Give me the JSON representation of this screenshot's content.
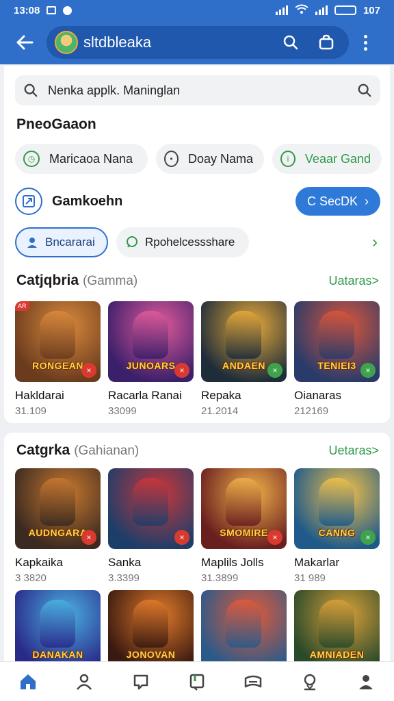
{
  "status_bar": {
    "time": "13:08",
    "right_text": "107"
  },
  "app_bar": {
    "title": "sltdbleaka"
  },
  "search": {
    "text": "Nenka applk. Maninglan"
  },
  "section": {
    "title": "PneoGaaon"
  },
  "chips": [
    {
      "label": "Maricaoa Nana"
    },
    {
      "label": "Doay Nama"
    },
    {
      "label": "Veaar Gand"
    }
  ],
  "game_row": {
    "label": "Gamkoehn",
    "button_label": "C SecDK"
  },
  "tags": [
    {
      "label": "Bncararai"
    },
    {
      "label": "Rpohelcessshare"
    }
  ],
  "categories": [
    {
      "title": "Catjqbria",
      "subtitle": "(Gamma)",
      "link": "Uataras>",
      "items": [
        {
          "name": "Hakldarai",
          "count": "31.109",
          "thumb_title": "RONGEAN",
          "corner": "AR",
          "badge": "red",
          "colors": [
            "#6b3b1e",
            "#d98a3c"
          ]
        },
        {
          "name": "Racarla Ranai",
          "count": "33099",
          "thumb_title": "JUNOARS",
          "badge": "red",
          "colors": [
            "#3a1f6a",
            "#e05a9a"
          ]
        },
        {
          "name": "Repaka",
          "count": "21.2014",
          "thumb_title": "ANDAEN",
          "badge": "green",
          "colors": [
            "#1f2d3a",
            "#e6a93a"
          ]
        },
        {
          "name": "Oianaras",
          "count": "212169",
          "thumb_title": "TENIEI3",
          "badge": "green",
          "colors": [
            "#2a3b6a",
            "#d9553a"
          ]
        }
      ]
    },
    {
      "title": "Catgrka",
      "subtitle": "(Gahianan)",
      "link": "Uetaras>",
      "items": [
        {
          "name": "Kapkaika",
          "count": "3 3820",
          "thumb_title": "AUDNGARA",
          "badge": "red",
          "colors": [
            "#3b2a20",
            "#c7782f"
          ]
        },
        {
          "name": "Sanka",
          "count": "3.3399",
          "thumb_title": "",
          "badge": "red",
          "colors": [
            "#1e3e6a",
            "#c9363a"
          ]
        },
        {
          "name": "Maplils Jolls",
          "count": "31.3899",
          "thumb_title": "SMOMIRE",
          "badge": "red",
          "colors": [
            "#6a1f1f",
            "#f0b04a"
          ]
        },
        {
          "name": "Makarlar",
          "count": "31 989",
          "thumb_title": "CANNG",
          "badge": "green",
          "colors": [
            "#1f5a8a",
            "#f0c04a"
          ]
        }
      ],
      "more": [
        {
          "thumb_title": "DANAKAN",
          "colors": [
            "#2a2a8a",
            "#4ab0e0"
          ]
        },
        {
          "thumb_title": "JONOVAN",
          "colors": [
            "#3a1a10",
            "#e07a2a"
          ]
        },
        {
          "thumb_title": "",
          "colors": [
            "#2a5a8a",
            "#e05a3a"
          ]
        },
        {
          "thumb_title": "AMNIADEN",
          "colors": [
            "#2a4a2a",
            "#d9a03a"
          ]
        }
      ]
    }
  ],
  "bottom_nav": [
    "home-icon",
    "profile-icon",
    "chat-icon",
    "notes-icon",
    "wallet-icon",
    "support-icon",
    "account-icon"
  ]
}
